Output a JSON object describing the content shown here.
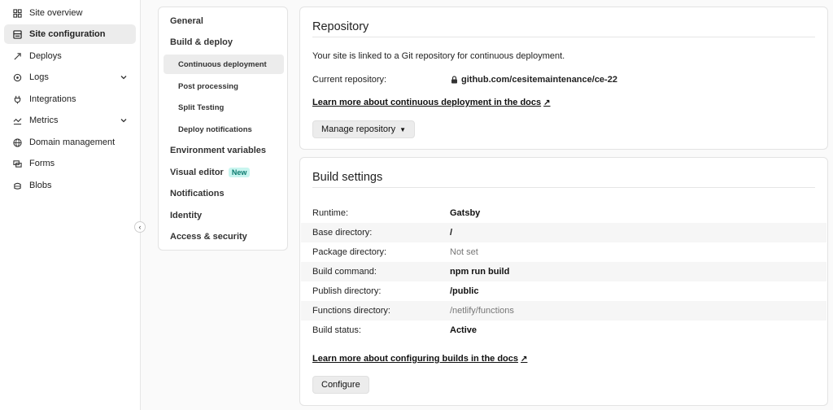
{
  "sidebar": {
    "items": [
      {
        "label": "Site overview",
        "icon": "grid-icon"
      },
      {
        "label": "Site configuration",
        "icon": "config-icon",
        "active": true
      },
      {
        "label": "Deploys",
        "icon": "rocket-icon"
      },
      {
        "label": "Logs",
        "icon": "logs-icon",
        "expandable": true
      },
      {
        "label": "Integrations",
        "icon": "plug-icon"
      },
      {
        "label": "Metrics",
        "icon": "metrics-icon",
        "expandable": true
      },
      {
        "label": "Domain management",
        "icon": "globe-icon"
      },
      {
        "label": "Forms",
        "icon": "forms-icon"
      },
      {
        "label": "Blobs",
        "icon": "blobs-icon"
      }
    ],
    "collapse_icon": "‹"
  },
  "subnav": {
    "items": [
      {
        "label": "General"
      },
      {
        "label": "Build & deploy"
      },
      {
        "label": "Continuous deployment"
      },
      {
        "label": "Post processing"
      },
      {
        "label": "Split Testing"
      },
      {
        "label": "Deploy notifications"
      },
      {
        "label": "Environment variables"
      },
      {
        "label": "Visual editor",
        "badge": "New"
      },
      {
        "label": "Notifications"
      },
      {
        "label": "Identity"
      },
      {
        "label": "Access & security"
      }
    ]
  },
  "repository": {
    "title": "Repository",
    "description": "Your site is linked to a Git repository for continuous deployment.",
    "current_label": "Current repository:",
    "current_value": "github.com/cesitemaintenance/ce-22",
    "learn_link": "Learn more about continuous deployment in the docs",
    "manage_button": "Manage repository"
  },
  "build": {
    "title": "Build settings",
    "rows": [
      {
        "label": "Runtime:",
        "value": "Gatsby"
      },
      {
        "label": "Base directory:",
        "value": "/"
      },
      {
        "label": "Package directory:",
        "value": "Not set"
      },
      {
        "label": "Build command:",
        "value": "npm run build"
      },
      {
        "label": "Publish directory:",
        "value": "/public"
      },
      {
        "label": "Functions directory:",
        "value": "/netlify/functions"
      },
      {
        "label": "Build status:",
        "value": "Active"
      }
    ],
    "learn_link": "Learn more about configuring builds in the docs",
    "configure_button": "Configure"
  },
  "colors": {
    "badge_bg": "#c8f5ef",
    "badge_text": "#0b7a6e",
    "active_bg": "#ececec"
  }
}
